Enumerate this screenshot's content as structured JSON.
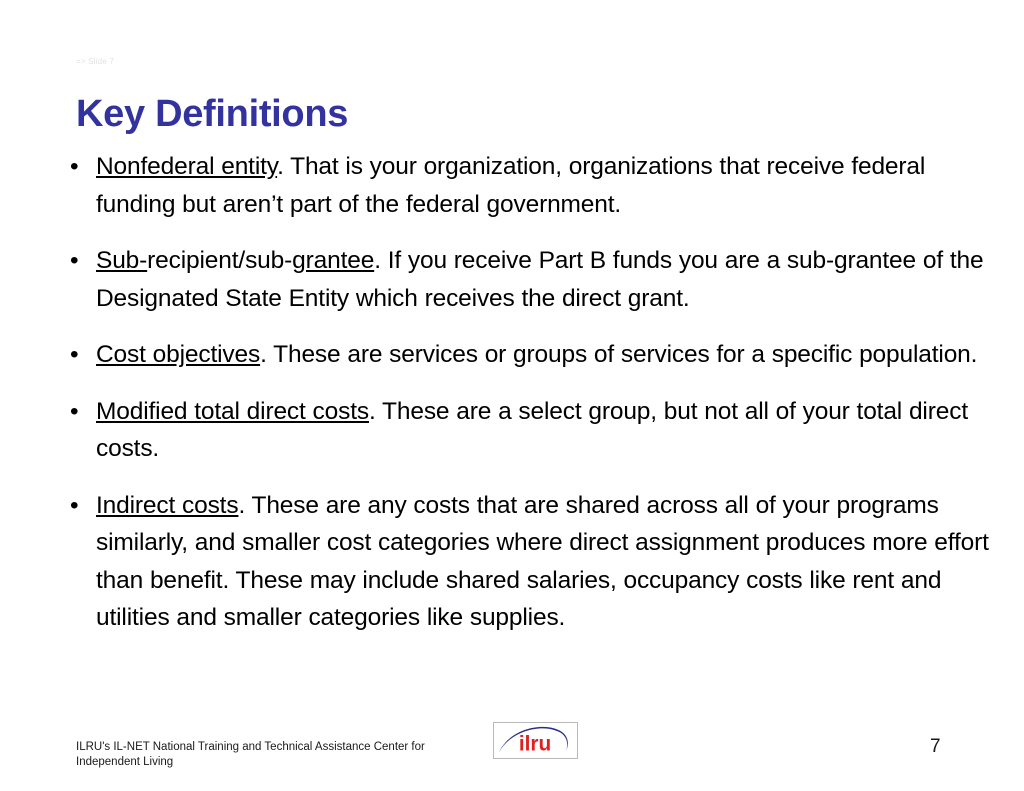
{
  "slide": {
    "note": "=> Slide 7",
    "title": "Key Definitions",
    "page_number": "7",
    "title_color": "#3333a0",
    "background_color": "#ffffff",
    "body_text_color": "#000000"
  },
  "bullets": [
    {
      "bullet_char": "•",
      "term": "Nonfederal entity",
      "rest": ". That is your organization, organizations that receive federal funding but aren’t part of the federal government.",
      "full_text": "Nonfederal entity. That is your organization, organizations that receive federal funding but aren’t part of the federal government."
    },
    {
      "bullet_char": "•",
      "term": "Sub-",
      "middle_plain": "recipient/sub-",
      "term2": "grantee",
      "rest": ". If you receive Part B funds you are a sub-grantee of the Designated State Entity which receives the direct grant.",
      "full_text": "Sub-recipient/sub-grantee. If you receive Part B funds you are a sub-grantee of the Designated State Entity which receives the direct grant."
    },
    {
      "bullet_char": "•",
      "term": "Cost objectives",
      "rest": ". These are services or groups of services for a specific population.",
      "full_text": "Cost objectives. These are services or groups of services for a specific population."
    },
    {
      "bullet_char": "•",
      "term": "Modified total direct costs",
      "rest": ".  These are a select group, but not all of your total direct costs.",
      "full_text": "Modified total direct costs.  These are a select group, but not all of your total direct costs."
    },
    {
      "bullet_char": "•",
      "term": "Indirect costs",
      "rest": ".  These are any costs that are shared across all of your programs similarly, and smaller cost categories where direct assignment produces more effort than benefit. These may include shared salaries, occupancy costs like rent and utilities and smaller categories like supplies.",
      "full_text": "Indirect costs.  These are any costs that are shared across all of your programs similarly, and smaller cost categories where direct assignment produces more effort than benefit. These may include shared salaries, occupancy costs like rent and utilities and smaller categories like supplies."
    }
  ],
  "footer": {
    "organization_line1": "ILRU's IL-NET National Training and Technical Assistance Center for",
    "organization_line2": "Independent Living",
    "logo": {
      "name": "ilru-logo",
      "wordmark": "ilru",
      "wordmark_color": "#e02020",
      "swoosh_color": "#2b2f86",
      "border_color": "#b9b9b9"
    }
  }
}
